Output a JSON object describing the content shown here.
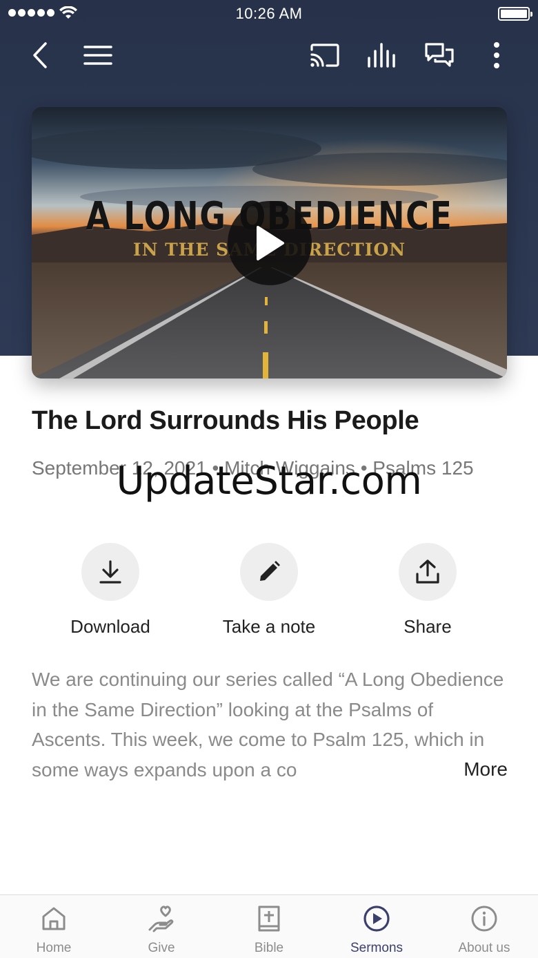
{
  "status_bar": {
    "time": "10:26 AM"
  },
  "nav": {
    "icons": [
      "back-icon",
      "menu-icon",
      "cast-icon",
      "audio-bars-icon",
      "chat-icon",
      "more-vertical-icon"
    ]
  },
  "video": {
    "title": "A LONG OBEDIENCE",
    "subtitle": "IN THE SAME DIRECTION"
  },
  "sermon": {
    "title": "The Lord Surrounds His People",
    "meta": "September 12, 2021 • Mitch Wiggains • Psalms 125"
  },
  "watermark": "UpdateStar.com",
  "actions": [
    {
      "label": "Download",
      "icon": "download-icon"
    },
    {
      "label": "Take a note",
      "icon": "pencil-icon"
    },
    {
      "label": "Share",
      "icon": "share-icon"
    }
  ],
  "description": {
    "text": "We are continuing our series called “A Long Obedience in the Same Direction” looking at the Psalms of Ascents. This week, we come to Psalm 125, which in some ways expands upon a co",
    "more_label": "More"
  },
  "tabs": [
    {
      "label": "Home",
      "icon": "home-icon",
      "active": false
    },
    {
      "label": "Give",
      "icon": "give-heart-icon",
      "active": false
    },
    {
      "label": "Bible",
      "icon": "bible-icon",
      "active": false
    },
    {
      "label": "Sermons",
      "icon": "play-circle-icon",
      "active": true
    },
    {
      "label": "About us",
      "icon": "info-icon",
      "active": false
    }
  ],
  "colors": {
    "header_bg": "#2b3650",
    "active_tab": "#3a3f6e",
    "inactive_tab": "#8c8c8c",
    "subtitle_gold": "#c9a24a"
  }
}
